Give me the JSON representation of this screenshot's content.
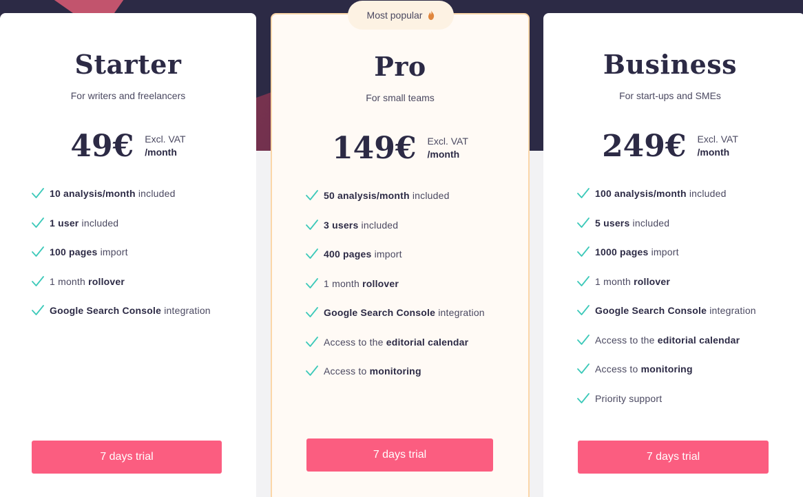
{
  "badge": {
    "label": "Most popular",
    "icon": "flame-icon"
  },
  "colors": {
    "accent": "#fb5d80",
    "check": "#3cc9b9",
    "dark_bg": "#2c2a45",
    "popular_border": "#fbd6a8"
  },
  "plans": [
    {
      "name": "Starter",
      "subtitle": "For writers and freelancers",
      "price": "49€",
      "vat": "Excl. VAT",
      "period": "/month",
      "cta": "7 days trial",
      "features": [
        [
          {
            "b": "10 analysis/month"
          },
          {
            "t": " included"
          }
        ],
        [
          {
            "b": "1 user"
          },
          {
            "t": " included"
          }
        ],
        [
          {
            "b": "100 pages"
          },
          {
            "t": " import"
          }
        ],
        [
          {
            "t": "1 month "
          },
          {
            "b": "rollover"
          }
        ],
        [
          {
            "b": "Google Search Console"
          },
          {
            "t": " integration"
          }
        ]
      ]
    },
    {
      "name": "Pro",
      "subtitle": "For small teams",
      "price": "149€",
      "vat": "Excl. VAT",
      "period": "/month",
      "cta": "7 days trial",
      "features": [
        [
          {
            "b": "50 analysis/month"
          },
          {
            "t": " included"
          }
        ],
        [
          {
            "b": "3 users"
          },
          {
            "t": " included"
          }
        ],
        [
          {
            "b": "400 pages"
          },
          {
            "t": " import"
          }
        ],
        [
          {
            "t": "1 month "
          },
          {
            "b": "rollover"
          }
        ],
        [
          {
            "b": "Google Search Console"
          },
          {
            "t": " integration"
          }
        ],
        [
          {
            "t": "Access to the "
          },
          {
            "b": "editorial calendar"
          }
        ],
        [
          {
            "t": "Access to "
          },
          {
            "b": "monitoring"
          }
        ]
      ]
    },
    {
      "name": "Business",
      "subtitle": "For start-ups and SMEs",
      "price": "249€",
      "vat": "Excl. VAT",
      "period": "/month",
      "cta": "7 days trial",
      "features": [
        [
          {
            "b": "100 analysis/month"
          },
          {
            "t": " included"
          }
        ],
        [
          {
            "b": "5 users"
          },
          {
            "t": " included"
          }
        ],
        [
          {
            "b": "1000 pages"
          },
          {
            "t": " import"
          }
        ],
        [
          {
            "t": "1 month "
          },
          {
            "b": "rollover"
          }
        ],
        [
          {
            "b": "Google Search Console"
          },
          {
            "t": " integration"
          }
        ],
        [
          {
            "t": "Access to the "
          },
          {
            "b": "editorial calendar"
          }
        ],
        [
          {
            "t": "Access to "
          },
          {
            "b": "monitoring"
          }
        ],
        [
          {
            "t": "Priority support"
          }
        ]
      ]
    }
  ]
}
